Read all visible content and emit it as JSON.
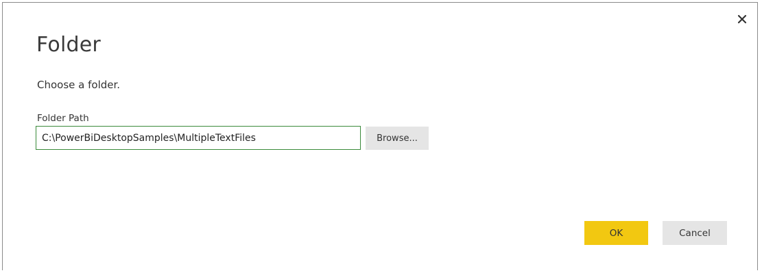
{
  "dialog": {
    "title": "Folder",
    "subtitle": "Choose a folder.",
    "close_icon": "close-icon"
  },
  "folder_path": {
    "label": "Folder Path",
    "value": "C:\\PowerBiDesktopSamples\\MultipleTextFiles",
    "browse_label": "Browse..."
  },
  "actions": {
    "ok_label": "OK",
    "cancel_label": "Cancel"
  },
  "colors": {
    "ok_button": "#f2c811",
    "secondary_button": "#e5e5e5",
    "input_focus_border": "#3a8a3a"
  }
}
